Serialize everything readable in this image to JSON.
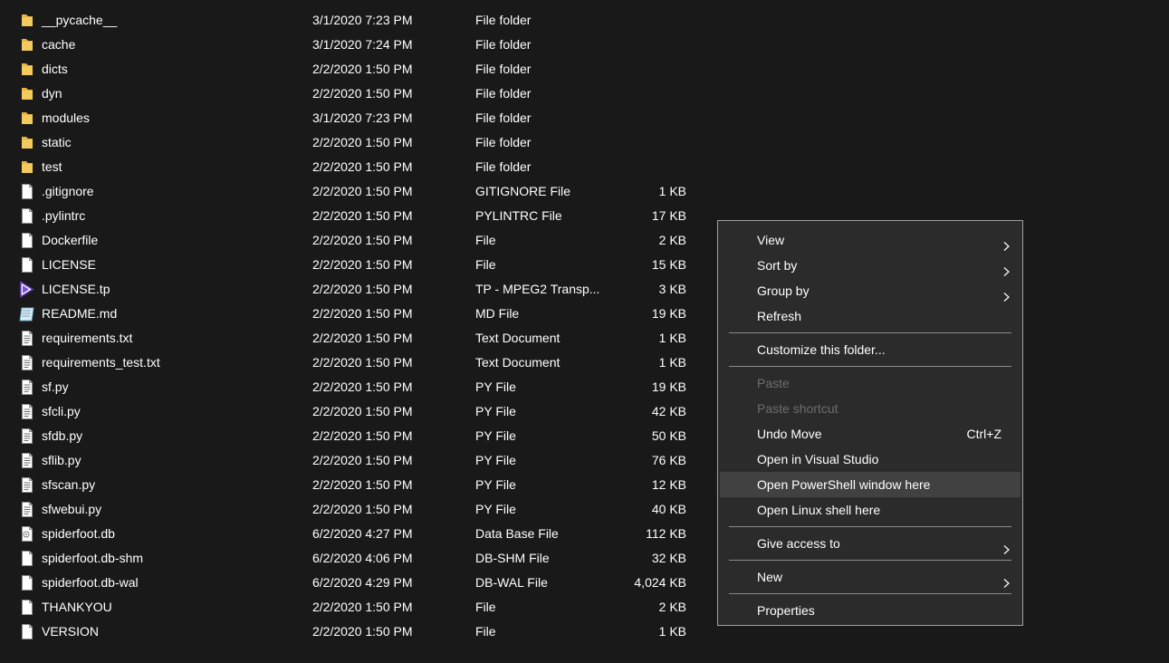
{
  "files": [
    {
      "name": "__pycache__",
      "date": "3/1/2020 7:23 PM",
      "type": "File folder",
      "size": "",
      "icon": "folder-icon"
    },
    {
      "name": "cache",
      "date": "3/1/2020 7:24 PM",
      "type": "File folder",
      "size": "",
      "icon": "folder-icon"
    },
    {
      "name": "dicts",
      "date": "2/2/2020 1:50 PM",
      "type": "File folder",
      "size": "",
      "icon": "folder-icon"
    },
    {
      "name": "dyn",
      "date": "2/2/2020 1:50 PM",
      "type": "File folder",
      "size": "",
      "icon": "folder-icon"
    },
    {
      "name": "modules",
      "date": "3/1/2020 7:23 PM",
      "type": "File folder",
      "size": "",
      "icon": "folder-icon"
    },
    {
      "name": "static",
      "date": "2/2/2020 1:50 PM",
      "type": "File folder",
      "size": "",
      "icon": "folder-icon"
    },
    {
      "name": "test",
      "date": "2/2/2020 1:50 PM",
      "type": "File folder",
      "size": "",
      "icon": "folder-icon"
    },
    {
      "name": ".gitignore",
      "date": "2/2/2020 1:50 PM",
      "type": "GITIGNORE File",
      "size": "1 KB",
      "icon": "file-icon"
    },
    {
      "name": ".pylintrc",
      "date": "2/2/2020 1:50 PM",
      "type": "PYLINTRC File",
      "size": "17 KB",
      "icon": "file-icon"
    },
    {
      "name": "Dockerfile",
      "date": "2/2/2020 1:50 PM",
      "type": "File",
      "size": "2 KB",
      "icon": "file-icon"
    },
    {
      "name": "LICENSE",
      "date": "2/2/2020 1:50 PM",
      "type": "File",
      "size": "15 KB",
      "icon": "file-icon"
    },
    {
      "name": "LICENSE.tp",
      "date": "2/2/2020 1:50 PM",
      "type": "TP - MPEG2 Transp...",
      "size": "3 KB",
      "icon": "media-file-icon"
    },
    {
      "name": "README.md",
      "date": "2/2/2020 1:50 PM",
      "type": "MD File",
      "size": "19 KB",
      "icon": "markdown-file-icon"
    },
    {
      "name": "requirements.txt",
      "date": "2/2/2020 1:50 PM",
      "type": "Text Document",
      "size": "1 KB",
      "icon": "text-file-icon"
    },
    {
      "name": "requirements_test.txt",
      "date": "2/2/2020 1:50 PM",
      "type": "Text Document",
      "size": "1 KB",
      "icon": "text-file-icon"
    },
    {
      "name": "sf.py",
      "date": "2/2/2020 1:50 PM",
      "type": "PY File",
      "size": "19 KB",
      "icon": "text-file-icon"
    },
    {
      "name": "sfcli.py",
      "date": "2/2/2020 1:50 PM",
      "type": "PY File",
      "size": "42 KB",
      "icon": "text-file-icon"
    },
    {
      "name": "sfdb.py",
      "date": "2/2/2020 1:50 PM",
      "type": "PY File",
      "size": "50 KB",
      "icon": "text-file-icon"
    },
    {
      "name": "sflib.py",
      "date": "2/2/2020 1:50 PM",
      "type": "PY File",
      "size": "76 KB",
      "icon": "text-file-icon"
    },
    {
      "name": "sfscan.py",
      "date": "2/2/2020 1:50 PM",
      "type": "PY File",
      "size": "12 KB",
      "icon": "text-file-icon"
    },
    {
      "name": "sfwebui.py",
      "date": "2/2/2020 1:50 PM",
      "type": "PY File",
      "size": "40 KB",
      "icon": "text-file-icon"
    },
    {
      "name": "spiderfoot.db",
      "date": "6/2/2020 4:27 PM",
      "type": "Data Base File",
      "size": "112 KB",
      "icon": "database-file-icon"
    },
    {
      "name": "spiderfoot.db-shm",
      "date": "6/2/2020 4:06 PM",
      "type": "DB-SHM File",
      "size": "32 KB",
      "icon": "file-icon"
    },
    {
      "name": "spiderfoot.db-wal",
      "date": "6/2/2020 4:29 PM",
      "type": "DB-WAL File",
      "size": "4,024 KB",
      "icon": "file-icon"
    },
    {
      "name": "THANKYOU",
      "date": "2/2/2020 1:50 PM",
      "type": "File",
      "size": "2 KB",
      "icon": "file-icon"
    },
    {
      "name": "VERSION",
      "date": "2/2/2020 1:50 PM",
      "type": "File",
      "size": "1 KB",
      "icon": "file-icon"
    }
  ],
  "context_menu": {
    "items": [
      {
        "label": "View",
        "submenu": true
      },
      {
        "label": "Sort by",
        "submenu": true
      },
      {
        "label": "Group by",
        "submenu": true
      },
      {
        "label": "Refresh"
      },
      {
        "separator": true
      },
      {
        "label": "Customize this folder..."
      },
      {
        "separator": true
      },
      {
        "label": "Paste",
        "disabled": true
      },
      {
        "label": "Paste shortcut",
        "disabled": true
      },
      {
        "label": "Undo Move",
        "shortcut": "Ctrl+Z"
      },
      {
        "label": "Open in Visual Studio"
      },
      {
        "label": "Open PowerShell window here",
        "highlighted": true
      },
      {
        "label": "Open Linux shell here"
      },
      {
        "separator": true
      },
      {
        "label": "Give access to",
        "submenu": true
      },
      {
        "separator": true
      },
      {
        "label": "New",
        "submenu": true
      },
      {
        "separator": true
      },
      {
        "label": "Properties"
      }
    ]
  },
  "colors": {
    "background": "#191919",
    "menu_background": "#2b2b2b",
    "menu_hover": "#414141",
    "folder": "#f1c155"
  }
}
